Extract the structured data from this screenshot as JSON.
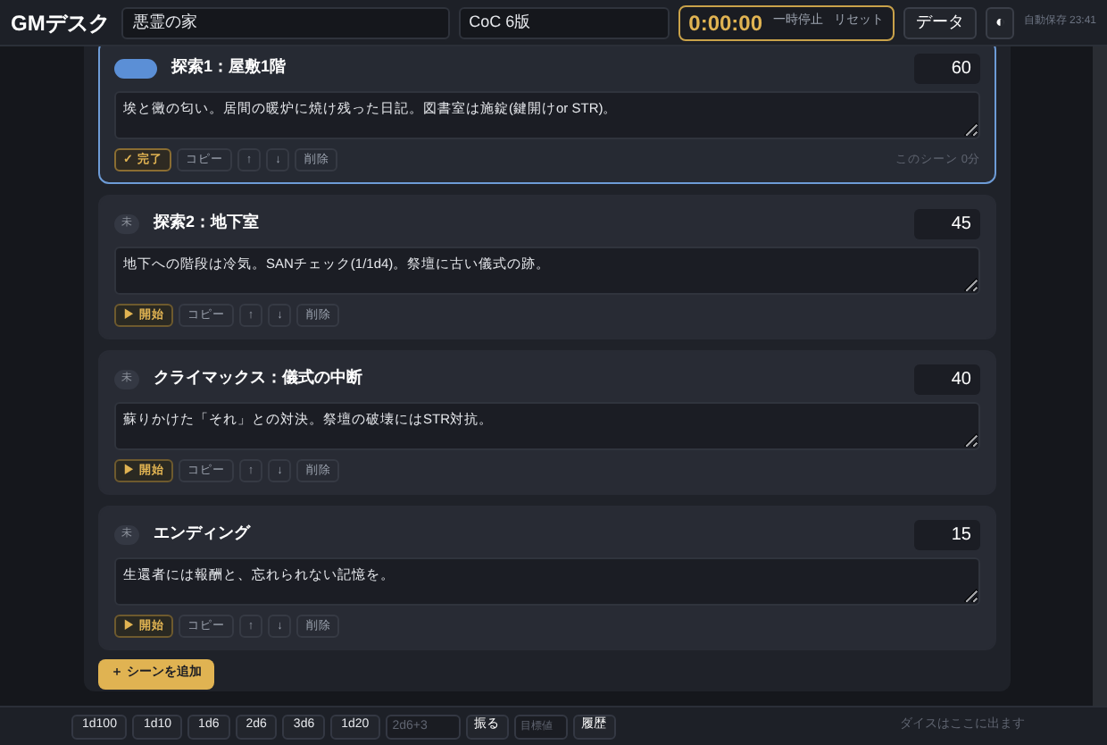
{
  "header": {
    "app_title": "GMデスク",
    "scenario": "悪霊の家",
    "system": "CoC 6版",
    "timer": "0:00:00",
    "pause": "一時停止",
    "reset": "リセット",
    "data_button": "データ",
    "theme_icon": "◐",
    "autosave": "自動保存 23:41"
  },
  "scenes": [
    {
      "current": true,
      "title": "探索1：屋敷1階",
      "minutes": "60",
      "note": "埃と黴の匂い。居間の暖炉に焼け残った日記。図書室は施錠(鍵開けor STR)。",
      "action": {
        "kind": "done",
        "label": "✓ 完了"
      },
      "buttons": {
        "copy": "コピー",
        "up": "↑",
        "down": "↓",
        "delete": "削除"
      },
      "elapsed": "このシーン 0分"
    },
    {
      "current": false,
      "badge": "未",
      "title": "探索2：地下室",
      "minutes": "45",
      "note": "地下への階段は冷気。SANチェック(1/1d4)。祭壇に古い儀式の跡。",
      "action": {
        "kind": "start",
        "label": "▶ 開始"
      },
      "buttons": {
        "copy": "コピー",
        "up": "↑",
        "down": "↓",
        "delete": "削除"
      }
    },
    {
      "current": false,
      "badge": "未",
      "title": "クライマックス：儀式の中断",
      "minutes": "40",
      "note": "蘇りかけた「それ」との対決。祭壇の破壊にはSTR対抗。",
      "action": {
        "kind": "start",
        "label": "▶ 開始"
      },
      "buttons": {
        "copy": "コピー",
        "up": "↑",
        "down": "↓",
        "delete": "削除"
      }
    },
    {
      "current": false,
      "badge": "未",
      "title": "エンディング",
      "minutes": "15",
      "note": "生還者には報酬と、忘れられない記憶を。",
      "action": {
        "kind": "start",
        "label": "▶ 開始"
      },
      "buttons": {
        "copy": "コピー",
        "up": "↑",
        "down": "↓",
        "delete": "削除"
      }
    }
  ],
  "add_scene": "＋ シーンを追加",
  "dice_bar": {
    "presets": [
      "1d100",
      "1d10",
      "1d6",
      "2d6",
      "3d6",
      "1d20"
    ],
    "expression_placeholder": "2d6+3",
    "roll": "振る",
    "target_placeholder": "目標値",
    "history": "履歴",
    "result": "ダイスはここに出ます"
  }
}
